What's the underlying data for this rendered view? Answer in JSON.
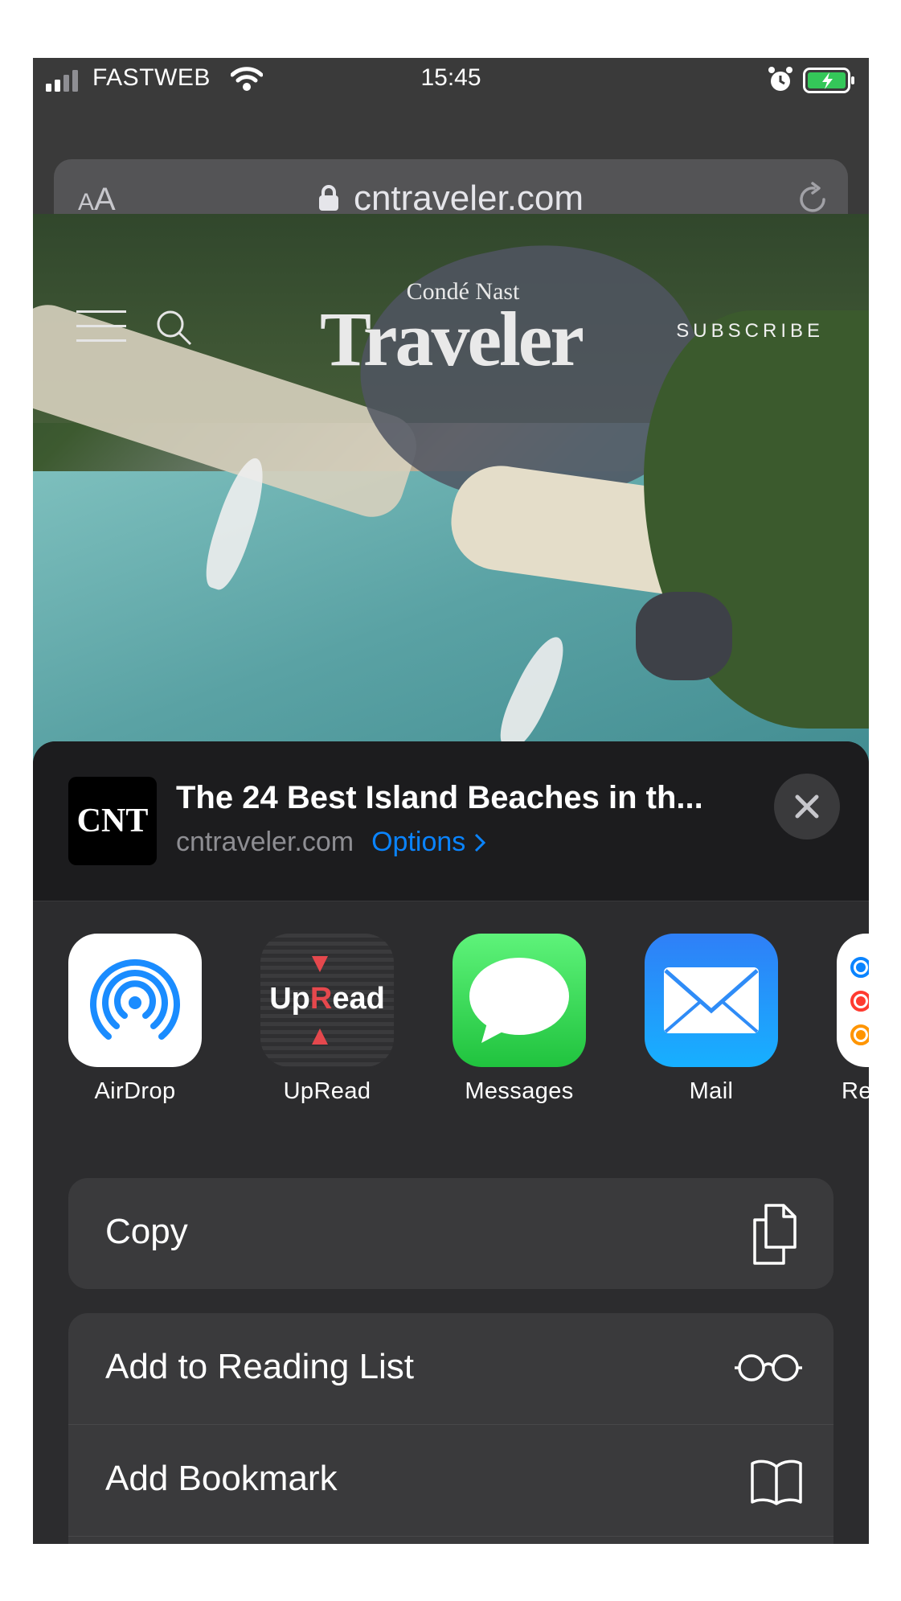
{
  "status_bar": {
    "carrier": "FASTWEB",
    "time": "15:45"
  },
  "browser": {
    "text_size_button": "AA",
    "url": "cntraveler.com"
  },
  "site": {
    "logo_top": "Condé Nast",
    "logo_main": "Traveler",
    "subscribe": "SUBSCRIBE"
  },
  "share_sheet": {
    "site_icon_text": "CNT",
    "page_title": "The 24 Best Island Beaches in th...",
    "page_domain": "cntraveler.com",
    "options_label": "Options",
    "apps": [
      {
        "label": "AirDrop"
      },
      {
        "label": "UpRead"
      },
      {
        "label": "Messages"
      },
      {
        "label": "Mail"
      },
      {
        "label": "Re"
      }
    ],
    "upread_logo": {
      "up": "Up",
      "r": "R",
      "ead": "ead"
    },
    "actions": [
      {
        "label": "Copy",
        "icon": "copy-icon"
      },
      {
        "label": "Add to Reading List",
        "icon": "glasses-icon"
      },
      {
        "label": "Add Bookmark",
        "icon": "book-icon"
      }
    ]
  },
  "colors": {
    "accent": "#0a84ff",
    "sheet_bg": "#1c1c1e",
    "row_bg": "#3a3a3c",
    "messages_green": "#34c759",
    "mail_blue": "#1a8cff"
  }
}
